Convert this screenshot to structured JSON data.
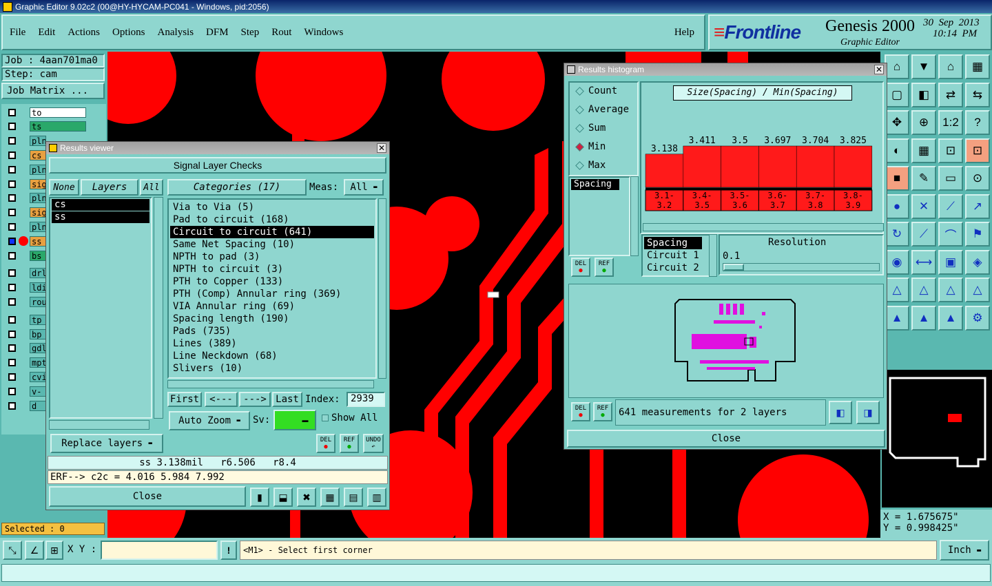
{
  "window": {
    "title": "Graphic Editor 9.02c2 (00@HY-HYCAM-PC041 - Windows, pid:2056)"
  },
  "menu": [
    "File",
    "Edit",
    "Actions",
    "Options",
    "Analysis",
    "DFM",
    "Step",
    "Rout",
    "Windows"
  ],
  "help": "Help",
  "brand": {
    "logo": "Frontline",
    "product": "Genesis 2000",
    "subtitle": "Graphic Editor",
    "date": "30  Sep  2013",
    "time": "10:14  PM"
  },
  "job": {
    "job": "Job : 4aan701ma0",
    "step": "Step: cam",
    "matrix": "Job Matrix ..."
  },
  "layers": [
    {
      "name": "to",
      "color": "#ffffff"
    },
    {
      "name": "ts",
      "color": "#2aa86a"
    },
    {
      "name": "plncs",
      "color": "#5ab8b0"
    },
    {
      "name": "cs",
      "color": "#e8a040"
    },
    {
      "name": "pln",
      "color": "#5ab8b0"
    },
    {
      "name": "sig",
      "color": "#e8a040"
    },
    {
      "name": "pln",
      "color": "#5ab8b0"
    },
    {
      "name": "sig",
      "color": "#e8a040"
    },
    {
      "name": "pln",
      "color": "#5ab8b0"
    },
    {
      "name": "ss",
      "color": "#e8a040"
    },
    {
      "name": "bs",
      "color": "#2aa86a"
    },
    {
      "name": "drl",
      "color": "#5ab8b0"
    },
    {
      "name": "ldi",
      "color": "#5ab8b0"
    },
    {
      "name": "rou",
      "color": "#5ab8b0"
    },
    {
      "name": "tp",
      "color": "#5ab8b0"
    },
    {
      "name": "bp",
      "color": "#5ab8b0"
    },
    {
      "name": "gdl",
      "color": "#5ab8b0"
    },
    {
      "name": "mpt",
      "color": "#5ab8b0"
    },
    {
      "name": "cvi",
      "color": "#5ab8b0"
    },
    {
      "name": "v-c",
      "color": "#5ab8b0"
    },
    {
      "name": "d",
      "color": "#5ab8b0"
    }
  ],
  "selected": "Selected : 0",
  "viewer": {
    "title": "Results viewer",
    "header": "Signal Layer Checks",
    "none": "None",
    "layers": "Layers",
    "all": "All",
    "layer_list": [
      "cs",
      "ss"
    ],
    "categories_label": "Categories (17)",
    "meas_label": "Meas:",
    "meas_value": "All",
    "categories": [
      "Via to Via (5)",
      "Pad to circuit (168)",
      "Circuit to circuit (641)",
      "Same Net Spacing (10)",
      "NPTH to pad (3)",
      "NPTH to circuit (3)",
      "PTH to Copper (133)",
      "PTH (Comp) Annular ring (369)",
      "VIA Annular ring (69)",
      "Spacing length (190)",
      "Pads (735)",
      "Lines (389)",
      "Line Neckdown (68)",
      "Slivers (10)"
    ],
    "first": "First",
    "prev": "<---",
    "next": "--->",
    "last": "Last",
    "index_label": "Index:",
    "index_value": "2939",
    "autozoom": "Auto Zoom",
    "sv": "Sv:",
    "showall": "Show All",
    "replace": "Replace layers",
    "del": "DEL",
    "ref": "REF",
    "undo": "UNDO",
    "status": "ss 3.138mil   r6.506   r8.4",
    "erf": "ERF--> c2c = 4.016 5.984 7.992",
    "close": "Close"
  },
  "histogram": {
    "title": "Results histogram",
    "modes": [
      "Count",
      "Average",
      "Sum",
      "Min",
      "Max"
    ],
    "selected_mode": "Min",
    "chart_title": "Size(Spacing) / Min(Spacing)",
    "left_list": [
      "Spacing"
    ],
    "del": "DEL",
    "ref": "REF",
    "sub_list": [
      "Spacing",
      "Circuit 1",
      "Circuit 2"
    ],
    "resolution_label": "Resolution",
    "resolution_value": "0.1",
    "summary": "641 measurements for 2 layers",
    "close": "Close"
  },
  "chart_data": {
    "type": "bar",
    "title": "Size(Spacing) / Min(Spacing)",
    "categories": [
      "3.1-3.2",
      "3.4-3.5",
      "3.5-3.6",
      "3.6-3.7",
      "3.7-3.8",
      "3.8-3.9"
    ],
    "values": [
      3.138,
      3.411,
      3.5,
      3.697,
      3.704,
      3.825
    ],
    "value_labels": [
      "3.138",
      "3.411",
      "3.5",
      "3.697",
      "3.704",
      "3.825"
    ],
    "category_labels": [
      [
        "3.1-",
        "3.2"
      ],
      [
        "3.4-",
        "3.5"
      ],
      [
        "3.5-",
        "3.6"
      ],
      [
        "3.6-",
        "3.7"
      ],
      [
        "3.7-",
        "3.8"
      ],
      [
        "3.8-",
        "3.9"
      ]
    ],
    "ylim": [
      2.4,
      3.9
    ],
    "color": "#ff1a1a"
  },
  "coords": {
    "x": "X = 1.675675\"",
    "y": "Y = 0.998425\""
  },
  "bottom": {
    "xy_label": "X Y :",
    "xy_value": "",
    "prompt": "<M1> - Select first corner",
    "units": "Inch"
  },
  "colors": {
    "copper": "#ff0000",
    "board": "#000000",
    "panel": "#8fd6cf"
  }
}
